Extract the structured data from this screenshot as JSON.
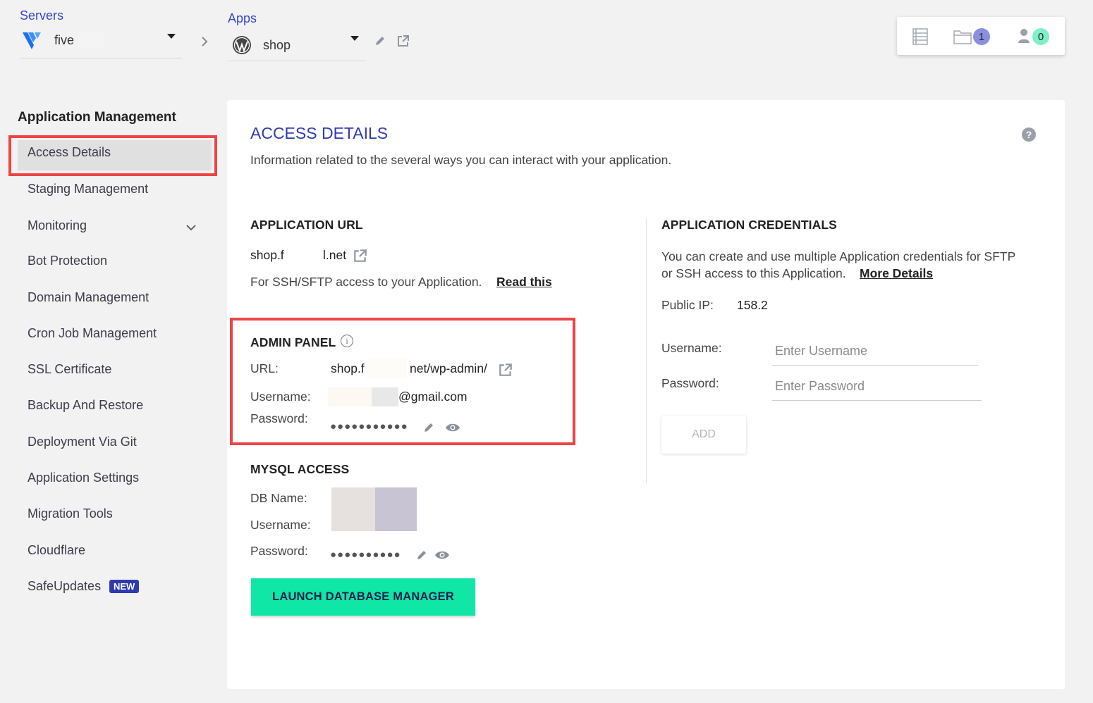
{
  "servers": {
    "label": "Servers",
    "value": "five"
  },
  "apps": {
    "label": "Apps",
    "value": "shop"
  },
  "top_counters": {
    "files": "1",
    "team": "0"
  },
  "colors": {
    "accent": "#2f3ab2",
    "launch": "#10e7a6",
    "highlight": "#ef4444"
  },
  "sidebar": {
    "title": "Application Management",
    "items": [
      {
        "label": "Access Details"
      },
      {
        "label": "Staging Management"
      },
      {
        "label": "Monitoring"
      },
      {
        "label": "Bot Protection"
      },
      {
        "label": "Domain Management"
      },
      {
        "label": "Cron Job Management"
      },
      {
        "label": "SSL Certificate"
      },
      {
        "label": "Backup And Restore"
      },
      {
        "label": "Deployment Via Git"
      },
      {
        "label": "Application Settings"
      },
      {
        "label": "Migration Tools"
      },
      {
        "label": "Cloudflare"
      },
      {
        "label": "SafeUpdates"
      }
    ],
    "new_badge": "NEW"
  },
  "main": {
    "title": "ACCESS DETAILS",
    "description": "Information related to the several ways you can interact with your application.",
    "app_url": {
      "heading": "APPLICATION URL",
      "url_start": "shop.f",
      "url_end": "l.net",
      "ssh_text": "For SSH/SFTP access to your Application.",
      "read_this": "Read this"
    },
    "admin_panel": {
      "heading": "ADMIN PANEL",
      "url_label": "URL:",
      "url_start": "shop.f",
      "url_end": "net/wp-admin/",
      "username_label": "Username:",
      "username_end": "@gmail.com",
      "password_label": "Password:",
      "password_mask": "●●●●●●●●●●●"
    },
    "mysql": {
      "heading": "MYSQL ACCESS",
      "db_label": "DB Name:",
      "username_label": "Username:",
      "password_label": "Password:",
      "password_mask": "●●●●●●●●●●",
      "launch_button": "LAUNCH DATABASE MANAGER"
    },
    "credentials": {
      "heading": "APPLICATION CREDENTIALS",
      "description_1": "You can create and use multiple Application credentials for SFTP",
      "description_2": "or SSH access to this Application.",
      "more_details": "More Details",
      "public_ip_label": "Public IP:",
      "public_ip_value": "158.2",
      "username_label": "Username:",
      "username_placeholder": "Enter Username",
      "password_label": "Password:",
      "password_placeholder": "Enter Password",
      "add_button": "ADD"
    }
  }
}
